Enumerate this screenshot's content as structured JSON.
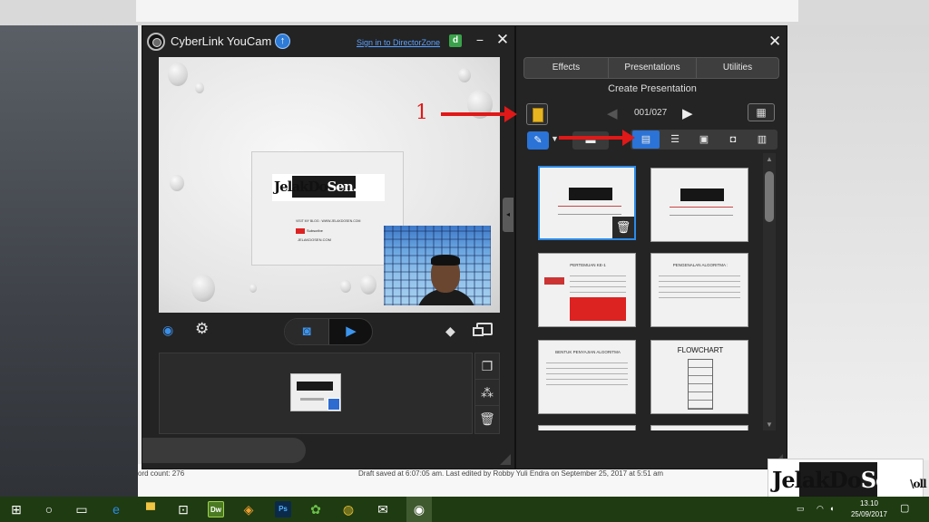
{
  "youcam": {
    "title": "CyberLink YouCam",
    "signin_link": "Sign in to DirectorZone",
    "minimize": "−",
    "close": "✕",
    "slide_logo_a": "JelakDo",
    "slide_logo_b": "Sen.",
    "slide_line1": "VISIT MY BLOG : WWW.JELAKDOSEN.COM",
    "slide_sub": "Subscribe",
    "slide_line3": "JELAKDOSEN.COM"
  },
  "panel": {
    "close": "✕",
    "tabs": [
      "Effects",
      "Presentations",
      "Utilities"
    ],
    "section_title": "Create Presentation",
    "page_counter": "001/027",
    "prev": "◀",
    "next": "▶",
    "thumbs": {
      "t3_title": "PERTEMUAN KE-1",
      "t4_title": "PENGENALAN ALGORITMA :",
      "t5_title": "BENTUK PENYAJIAN ALGORITMA",
      "t6_title": "FLOWCHART"
    }
  },
  "annotations": {
    "number": "1"
  },
  "background": {
    "word_count": "ord count: 276",
    "draft": "Draft saved at 6:07:05 am. Last edited by Robby Yuli Endra on September 25, 2017 at 5:51 am"
  },
  "watermark": {
    "a": "JelakDo",
    "b": "Sen.",
    "c": "\\oll"
  },
  "taskbar": {
    "dw_label": "Dw",
    "ps_label": "Ps",
    "time": "13.10",
    "date": "25/09/2017"
  }
}
